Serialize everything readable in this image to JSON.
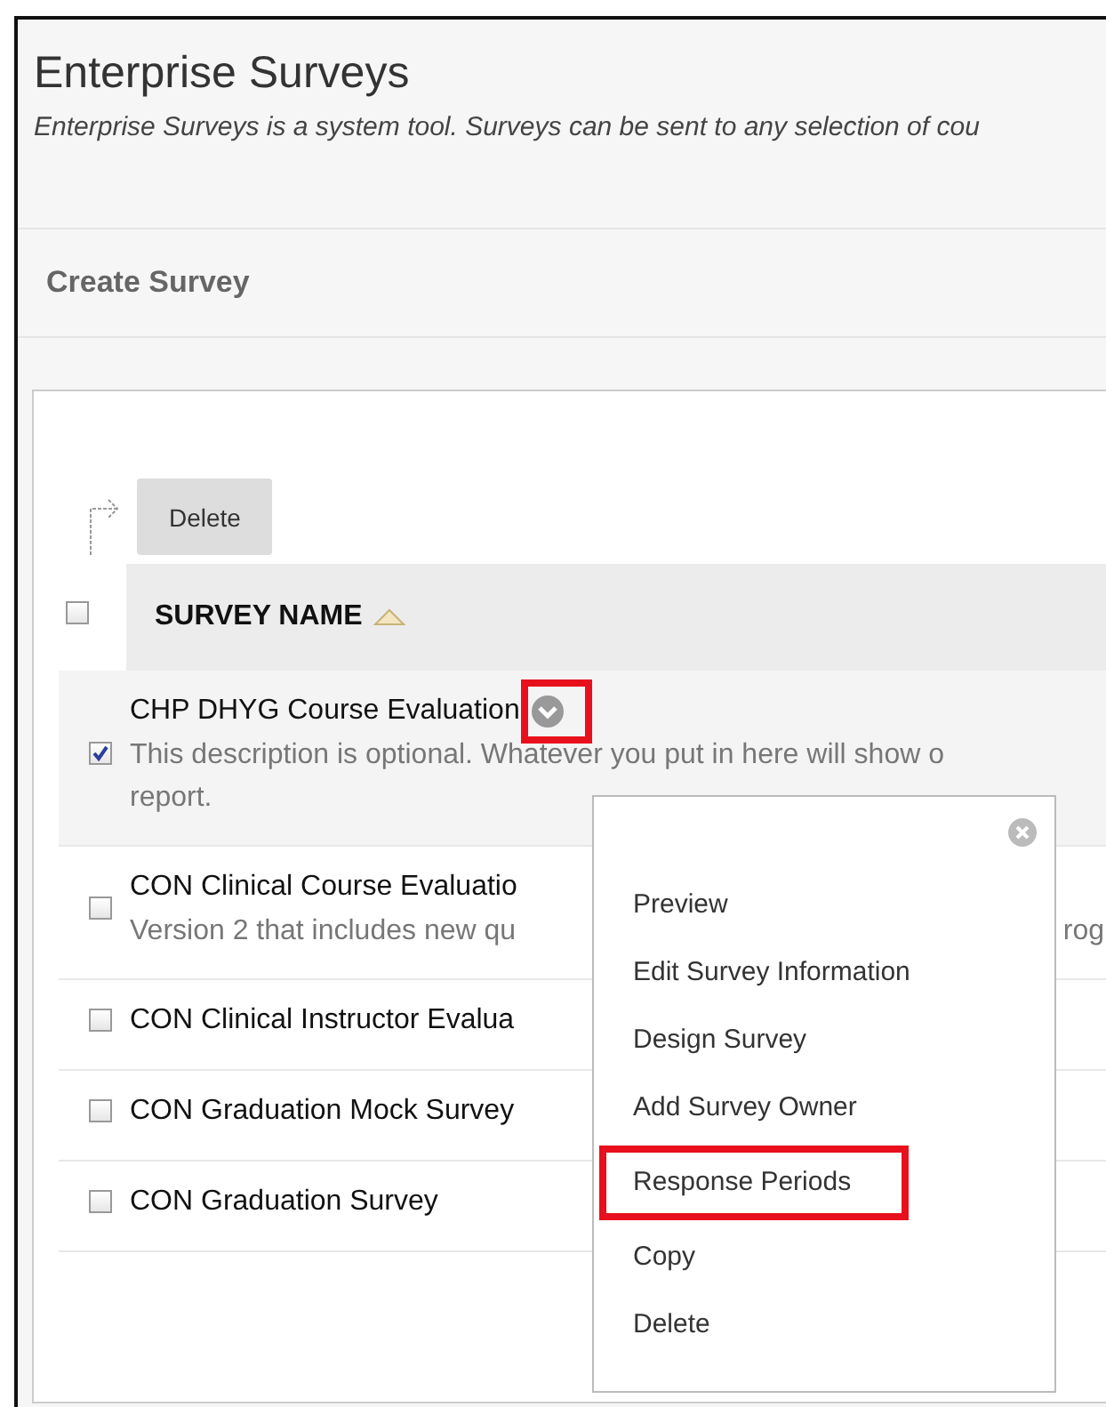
{
  "page": {
    "title": "Enterprise Surveys",
    "description": "Enterprise Surveys is a system tool. Surveys can be sent to any selection of cou"
  },
  "create_button": "Create Survey",
  "toolbar": {
    "delete_button": "Delete"
  },
  "table": {
    "header": {
      "label": "SURVEY NAME",
      "checked": false
    },
    "rows": [
      {
        "name": "CHP DHYG Course Evaluation",
        "description": "This description is optional. Whatever you put in here will show o",
        "description_line_2": "report.",
        "checked": true,
        "menu_open": true,
        "menu_highlighted": true
      },
      {
        "name": "CON Clinical Course Evaluatio",
        "description": "Version 2 that includes new qu",
        "description_tail": "rog",
        "checked": false
      },
      {
        "name": "CON Clinical Instructor Evalua",
        "checked": false
      },
      {
        "name": "CON Graduation Mock Survey",
        "checked": false
      },
      {
        "name": "CON Graduation Survey",
        "checked": false
      }
    ]
  },
  "context_menu": {
    "items": [
      {
        "label": "Preview",
        "highlighted": false
      },
      {
        "label": "Edit Survey Information",
        "highlighted": false
      },
      {
        "label": "Design Survey",
        "highlighted": false
      },
      {
        "label": "Add Survey Owner",
        "highlighted": false
      },
      {
        "label": "Response Periods",
        "highlighted": true
      },
      {
        "label": "Copy",
        "highlighted": false
      },
      {
        "label": "Delete",
        "highlighted": false
      }
    ]
  }
}
